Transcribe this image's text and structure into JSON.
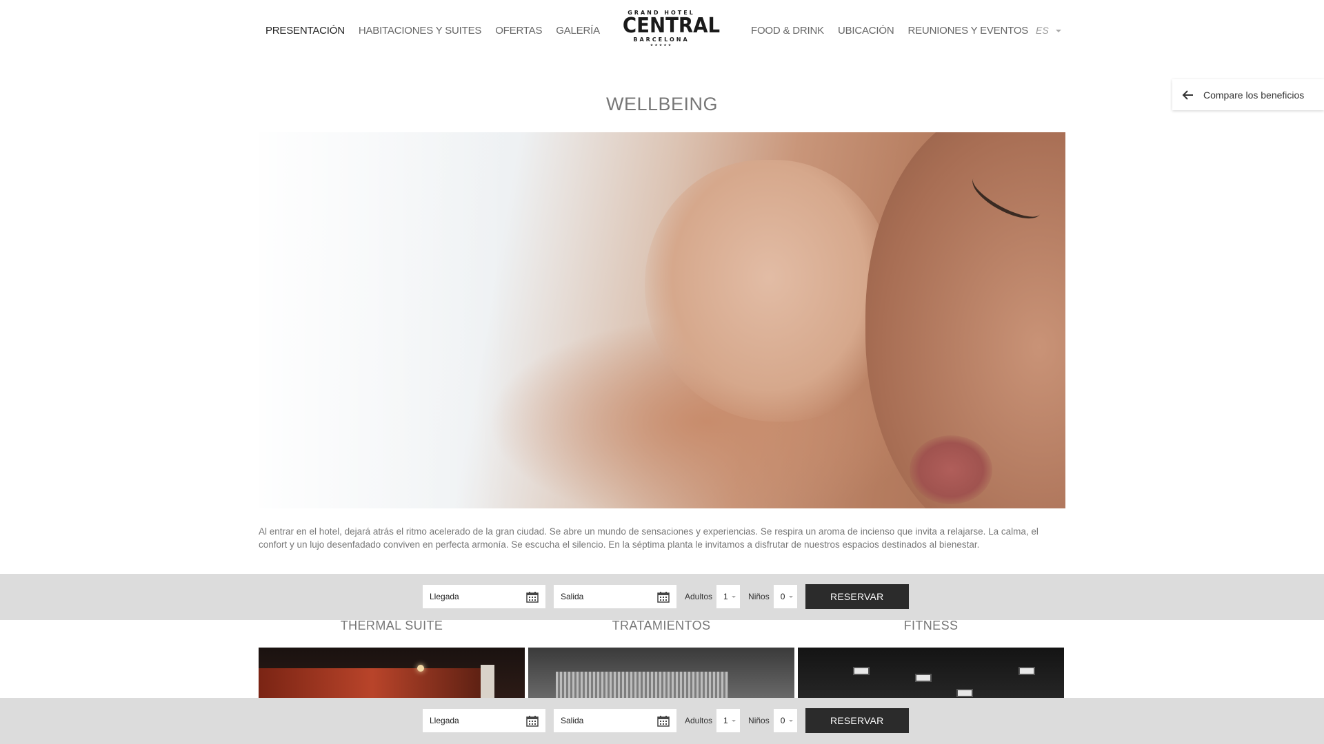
{
  "nav": {
    "left": [
      "PRESENTACIÓN",
      "HABITACIONES Y SUITES",
      "OFERTAS",
      "GALERÍA"
    ],
    "right": [
      "FOOD & DRINK",
      "UBICACIÓN",
      "REUNIONES Y EVENTOS"
    ],
    "active_index": 0,
    "language": "ES"
  },
  "logo": {
    "line1": "GRAND HOTEL",
    "line2": "CENTRAL",
    "line3": "BARCELONA",
    "stars": "★★★★★"
  },
  "compare": {
    "label": "Compare los beneficios",
    "icon": "arrow-left-icon"
  },
  "page": {
    "title": "WELLBEING",
    "description": "Al entrar en el hotel, dejará atrás el ritmo acelerado de la gran ciudad. Se abre un mundo de sensaciones y experiencias. Se respira un aroma de incienso que invita a relajarse. La calma, el confort y un lujo desenfadado conviven en perfecta armonía. Se escucha el silencio. En la séptima planta le invitamos a disfrutar de nuestros espacios destinados al bienestar."
  },
  "booking": {
    "arrival_placeholder": "Llegada",
    "departure_placeholder": "Salida",
    "adults_label": "Adultos",
    "adults_value": "1",
    "children_label": "Niños",
    "children_value": "0",
    "reserve_label": "RESERVAR"
  },
  "sections": [
    {
      "title": "THERMAL SUITE"
    },
    {
      "title": "TRATAMIENTOS"
    },
    {
      "title": "FITNESS"
    }
  ],
  "colors": {
    "booking_bar_bg": "#dcdcdc",
    "reserve_button_bg": "#2b2b2b",
    "nav_text": "#666666",
    "title_text": "#777777"
  }
}
